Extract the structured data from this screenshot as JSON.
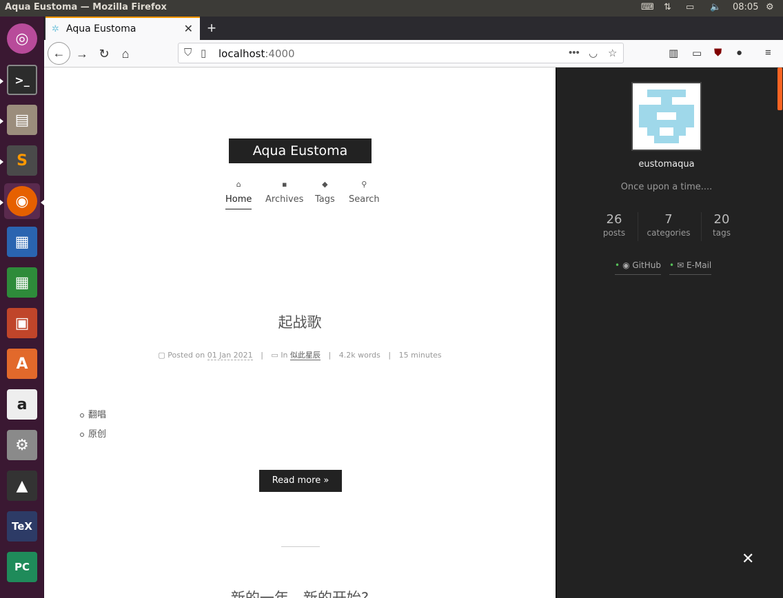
{
  "os": {
    "window_title": "Aqua Eustoma — Mozilla Firefox",
    "clock": "08:05"
  },
  "browser": {
    "tab_title": "Aqua Eustoma",
    "url_host": "localhost",
    "url_port": ":4000",
    "new_tab_label": "+"
  },
  "site": {
    "brand": "Aqua Eustoma",
    "menu": [
      {
        "label": "Home",
        "icon": "home-icon"
      },
      {
        "label": "Archives",
        "icon": "archive-icon"
      },
      {
        "label": "Tags",
        "icon": "tags-icon"
      },
      {
        "label": "Search",
        "icon": "search-icon"
      }
    ]
  },
  "post": {
    "title": "起战歌",
    "posted_on_label": "Posted on",
    "date": "01 Jan 2021",
    "in_label": "In",
    "category": "似此星辰",
    "words": "4.2k words",
    "duration": "15 minutes",
    "list": [
      "翻唱",
      "原创"
    ],
    "read_more": "Read more »"
  },
  "next_post": {
    "title": "新的一年，新的开始?"
  },
  "sidebar": {
    "author": "eustomaqua",
    "description": "Once upon a time....",
    "stats": [
      {
        "count": "26",
        "label": "posts"
      },
      {
        "count": "7",
        "label": "categories"
      },
      {
        "count": "20",
        "label": "tags"
      }
    ],
    "links": [
      {
        "label": "GitHub",
        "icon": "github-icon"
      },
      {
        "label": "E-Mail",
        "icon": "envelope-icon"
      }
    ],
    "close": "✕"
  },
  "colors": {
    "accent": "#fc6423",
    "sidebar_bg": "#222222",
    "brand_bg": "#222222",
    "avatar": "#9fd8ea"
  }
}
